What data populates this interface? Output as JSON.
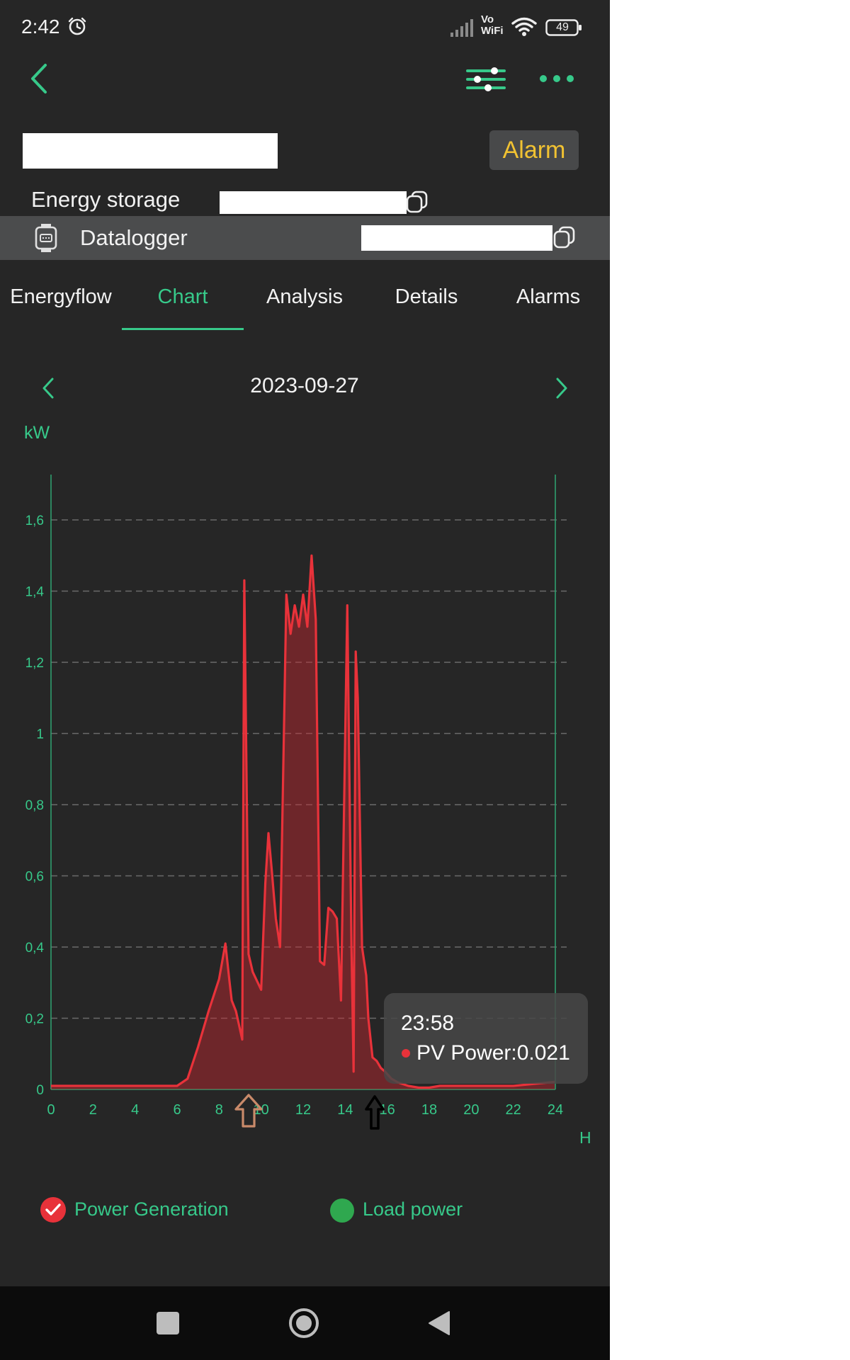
{
  "status_bar": {
    "time": "2:42",
    "network": "Vo\nWiFi",
    "battery": "49"
  },
  "header": {
    "alarm_button": "Alarm",
    "energy_storage_label": "Energy storage",
    "datalogger_label": "Datalogger"
  },
  "tabs": [
    {
      "label": "Energyflow",
      "active": false
    },
    {
      "label": "Chart",
      "active": true
    },
    {
      "label": "Analysis",
      "active": false
    },
    {
      "label": "Details",
      "active": false
    },
    {
      "label": "Alarms",
      "active": false
    }
  ],
  "date_nav": {
    "date": "2023-09-27"
  },
  "tooltip": {
    "time": "23:58",
    "value": "PV Power:0.021"
  },
  "legend": [
    {
      "label": "Power Generation",
      "color": "#e8323a",
      "checked": true
    },
    {
      "label": "Load power",
      "color": "#2fa84f",
      "checked": false
    }
  ],
  "colors": {
    "accent": "#37c98a",
    "alarm": "#f1c232",
    "series": "#e8323a"
  },
  "chart_data": {
    "type": "area",
    "ylabel": "kW",
    "xlabel": "H",
    "xlim": [
      0,
      24
    ],
    "ylim": [
      0,
      1.6
    ],
    "x_ticks": [
      "0",
      "2",
      "4",
      "6",
      "8",
      "10",
      "12",
      "14",
      "16",
      "18",
      "20",
      "22",
      "24"
    ],
    "y_ticks": [
      "0",
      "0,2",
      "0,4",
      "0,6",
      "0,8",
      "1",
      "1,2",
      "1,4",
      "1,6"
    ],
    "grid": "horizontal dashed",
    "series": [
      {
        "name": "Power Generation",
        "x": [
          0,
          2,
          4,
          6,
          6.5,
          7,
          7.5,
          8,
          8.3,
          8.5,
          8.6,
          8.8,
          9.1,
          9.2,
          9.4,
          9.6,
          10,
          10.2,
          10.35,
          10.5,
          10.7,
          10.9,
          11.2,
          11.4,
          11.6,
          11.8,
          12.0,
          12.2,
          12.4,
          12.6,
          12.8,
          13.0,
          13.2,
          13.4,
          13.6,
          13.8,
          14.1,
          14.3,
          14.4,
          14.5,
          14.6,
          14.8,
          15.0,
          15.1,
          15.3,
          15.5,
          15.7,
          15.9,
          16.2,
          16.5,
          17.0,
          17.5,
          18.0,
          18.5,
          19.0,
          20,
          22,
          23.97
        ],
        "values": [
          0.01,
          0.01,
          0.01,
          0.01,
          0.03,
          0.12,
          0.22,
          0.31,
          0.41,
          0.3,
          0.25,
          0.22,
          0.14,
          1.43,
          0.38,
          0.33,
          0.28,
          0.58,
          0.72,
          0.62,
          0.48,
          0.4,
          1.39,
          1.28,
          1.36,
          1.3,
          1.39,
          1.3,
          1.5,
          1.32,
          0.36,
          0.35,
          0.51,
          0.5,
          0.48,
          0.25,
          1.36,
          0.4,
          0.05,
          1.23,
          1.1,
          0.4,
          0.32,
          0.2,
          0.09,
          0.08,
          0.06,
          0.05,
          0.03,
          0.02,
          0.01,
          0.005,
          0.005,
          0.01,
          0.01,
          0.01,
          0.01,
          0.021
        ]
      }
    ],
    "tooltip": {
      "time": "23:58",
      "value": 0.021
    }
  }
}
